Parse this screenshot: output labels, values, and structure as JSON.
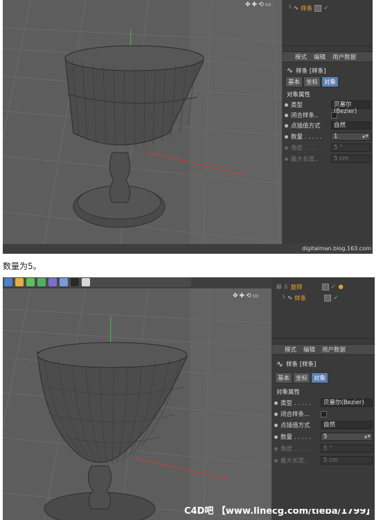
{
  "top": {
    "obj_spline": "样条",
    "tabs_header": [
      "模式",
      "编辑",
      "用户数据"
    ],
    "spline_title": "样条 [样条]",
    "tabs": [
      "基本",
      "坐标",
      "对象"
    ],
    "section": "对象属性",
    "props": [
      {
        "label": "类型",
        "value": "贝塞尔(Bezier)"
      },
      {
        "label": "闭合样条..",
        "value": ""
      },
      {
        "label": "点插值方式",
        "value": "自然"
      },
      {
        "label": "数量 . . . . .",
        "value": "1"
      },
      {
        "label": "角度 . . . . .",
        "value": "5 °"
      },
      {
        "label": "最大长度..",
        "value": "5 cm"
      }
    ],
    "watermark": "digitalman.blog.163.com"
  },
  "caption": "数量为5。",
  "bottom": {
    "obj_lathe": "旋转",
    "obj_spline": "样条",
    "tabs_header": [
      "模式",
      "编辑",
      "用户数据"
    ],
    "spline_title": "样条 [样条]",
    "tabs": [
      "基本",
      "坐标",
      "对象"
    ],
    "section": "对象属性",
    "props": [
      {
        "label": "类型 . . . . .",
        "value": "贝塞尔(Bezier)"
      },
      {
        "label": "闭合样条...",
        "value": ""
      },
      {
        "label": "点插值方式",
        "value": "自然"
      },
      {
        "label": "数量 . . . . .",
        "value": "5"
      },
      {
        "label": "角度 . . . . .",
        "value": "5 °"
      },
      {
        "label": "最大长度..",
        "value": "5 cm"
      }
    ],
    "watermark": "C4D吧 【www.linecg.com/tieba/1799】"
  },
  "colors": {
    "spline_orange": "#f0a030",
    "active_tab": "#5b7fb0",
    "y_axis": "#37c837",
    "x_axis": "#d83a3a"
  }
}
